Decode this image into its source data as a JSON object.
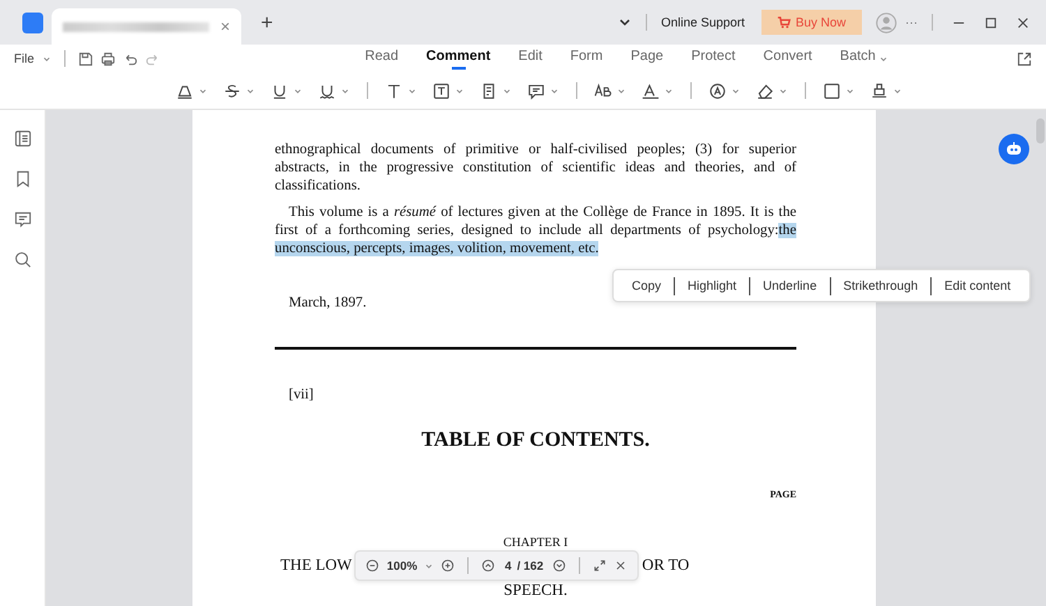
{
  "titlebar": {
    "new_tab": "+",
    "close_tab": "×",
    "support": "Online Support",
    "buy": "Buy Now",
    "more": "···"
  },
  "menu": {
    "file": "File",
    "tabs": [
      {
        "label": "Read",
        "selected": false
      },
      {
        "label": "Comment",
        "selected": true
      },
      {
        "label": "Edit",
        "selected": false
      },
      {
        "label": "Form",
        "selected": false
      },
      {
        "label": "Page",
        "selected": false
      },
      {
        "label": "Protect",
        "selected": false
      },
      {
        "label": "Convert",
        "selected": false
      },
      {
        "label": "Batch",
        "selected": false,
        "dropdown": true
      }
    ]
  },
  "tools": [
    {
      "kind": "highlight"
    },
    {
      "kind": "strike"
    },
    {
      "kind": "underline"
    },
    {
      "kind": "squiggly",
      "sep": true
    },
    {
      "kind": "text"
    },
    {
      "kind": "textbox"
    },
    {
      "kind": "note"
    },
    {
      "kind": "comment",
      "sep": true
    },
    {
      "kind": "replace"
    },
    {
      "kind": "insert",
      "sep": true
    },
    {
      "kind": "stamp-a"
    },
    {
      "kind": "eraser",
      "sep": true
    },
    {
      "kind": "shape"
    },
    {
      "kind": "sign"
    }
  ],
  "document": {
    "paragraphs": [
      {
        "text": "ethnographical documents of primitive or half-civilised peoples; (3) for superior abstracts, in the progressive constitution of scientific ideas and theories, and of classifications.",
        "indent": false
      },
      {
        "text": "This volume is a *résumé* of lectures given at the Collège de France in 1895. It is the first of a forthcoming series, designed to include all departments of psychology:",
        "indent": true,
        "highlighted": "the unconscious, percepts, images, volition, movement, etc."
      }
    ],
    "date": "March, 1897.",
    "page_mark": "[vii]",
    "heading": "TABLE OF CONTENTS.",
    "page_label": "PAGE",
    "chapter": "CHAPTER I",
    "line_start": "THE LOW",
    "line_end": "OR TO",
    "line2": "SPEECH."
  },
  "context_menu": [
    "Copy",
    "Highlight",
    "Underline",
    "Strikethrough",
    "Edit content"
  ],
  "zoombar": {
    "zoom": "100%",
    "page": "4",
    "total": "/ 162"
  }
}
